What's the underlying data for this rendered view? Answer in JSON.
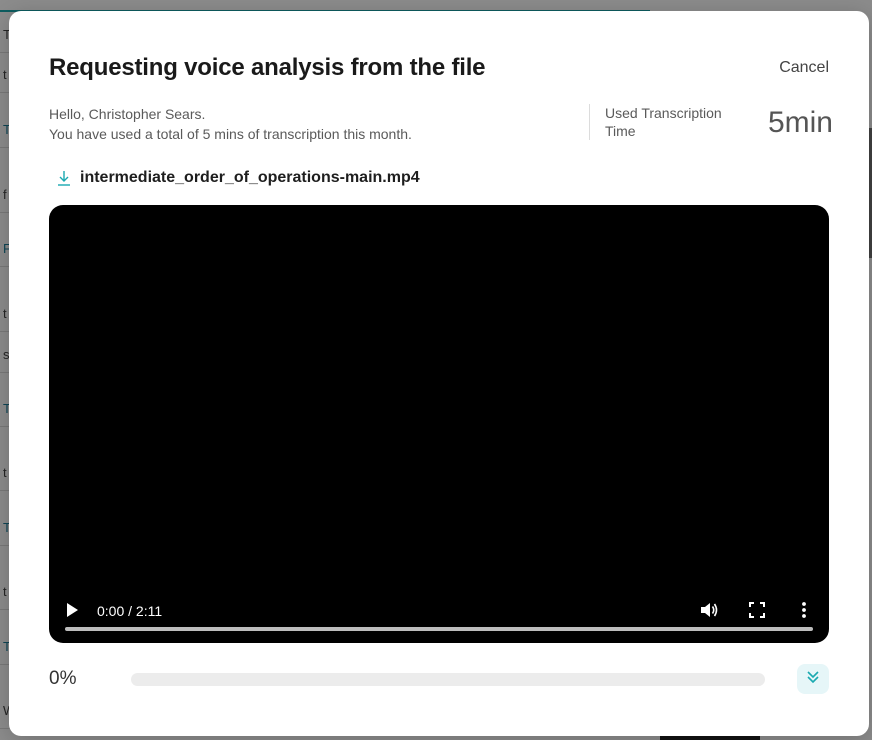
{
  "background_app": {
    "left_letters": [
      {
        "text": "T",
        "teal": false
      },
      {
        "text": "t",
        "teal": false
      },
      {
        "text": "T",
        "teal": true
      },
      {
        "text": "f",
        "teal": false
      },
      {
        "text": "F",
        "teal": true
      },
      {
        "text": "t",
        "teal": false
      },
      {
        "text": "s",
        "teal": false
      },
      {
        "text": "T",
        "teal": true
      },
      {
        "text": "t",
        "teal": false
      },
      {
        "text": "T",
        "teal": true
      },
      {
        "text": "t",
        "teal": false
      },
      {
        "text": "T",
        "teal": true
      },
      {
        "text": "W",
        "teal": false
      }
    ]
  },
  "modal": {
    "title": "Requesting voice analysis from the file",
    "cancel_label": "Cancel",
    "greeting_line1": "Hello, Christopher Sears.",
    "greeting_line2": "You have used a total of 5 mins of transcription this month.",
    "usage_label": "Used Transcription Time",
    "usage_value": "5min",
    "file_name": "intermediate_order_of_operations-main.mp4",
    "video": {
      "time_display": "0:00 / 2:11",
      "progress": 0
    },
    "analysis_progress_text": "0%",
    "analysis_progress": 0
  },
  "colors": {
    "accent": "#19a9b0",
    "expand_button_bg": "#e6f6f8",
    "video_bg": "#000000"
  },
  "icons": {
    "download": "download-icon",
    "play": "play-icon",
    "volume": "volume-icon",
    "fullscreen": "fullscreen-icon",
    "more": "more-vert-icon",
    "expand": "double-chevron-down-icon"
  }
}
